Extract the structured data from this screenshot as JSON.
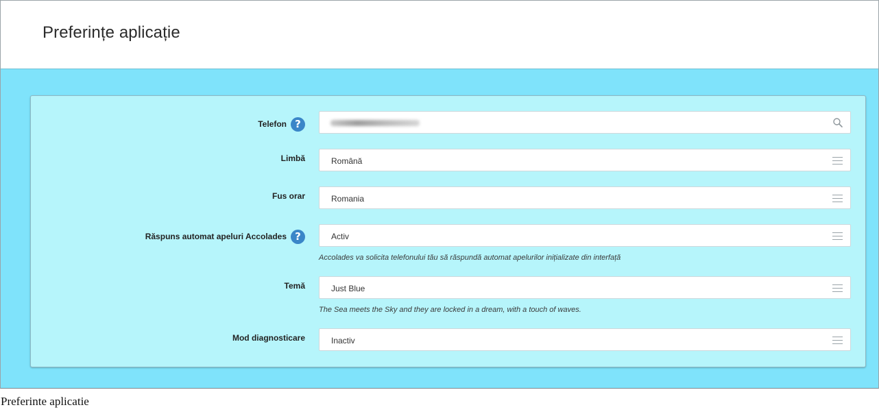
{
  "page": {
    "title": "Preferințe aplicație"
  },
  "form": {
    "phone": {
      "label": "Telefon",
      "value": ""
    },
    "language": {
      "label": "Limbă",
      "value": "Română"
    },
    "timezone": {
      "label": "Fus orar",
      "value": "Romania"
    },
    "autoanswer": {
      "label": "Răspuns automat apeluri Accolades",
      "value": "Activ",
      "hint": "Accolades va solicita telefonului tău să răspundă automat apelurilor inițializate din interfață"
    },
    "theme": {
      "label": "Temă",
      "value": "Just Blue",
      "hint": "The Sea meets the Sky and they are locked in a dream, with a touch of waves."
    },
    "diagnostics": {
      "label": "Mod diagnosticare",
      "value": "Inactiv"
    }
  },
  "icons": {
    "help": "?",
    "search": "search-icon",
    "select": "hamburger-menu-icon"
  },
  "caption": "Preferinte aplicatie",
  "colors": {
    "background": "#7fe3fb",
    "panel": "#b6f5fb",
    "help": "#3a86c8"
  }
}
